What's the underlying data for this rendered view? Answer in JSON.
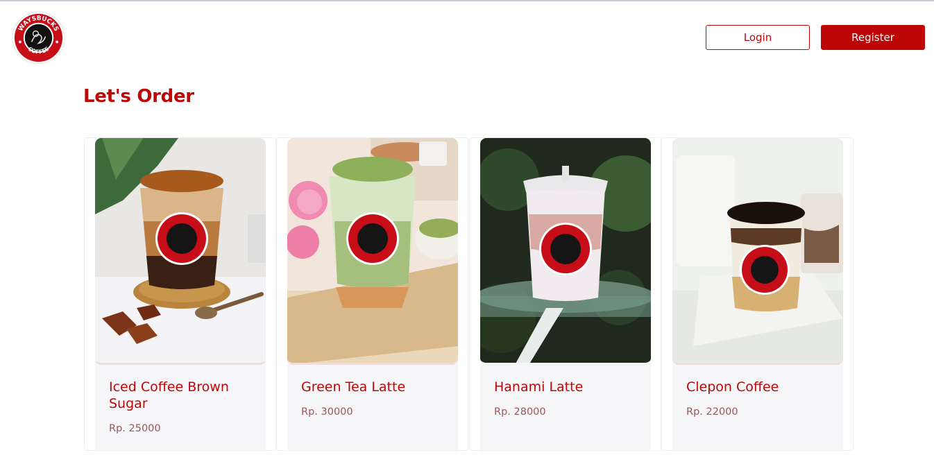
{
  "header": {
    "logo_alt": "Waysbucks Coffee logo",
    "logo_top_text": "WAYSBUCKS",
    "logo_bottom_text": "COFFEE",
    "login_label": "Login",
    "register_label": "Register"
  },
  "page": {
    "title": "Let's Order"
  },
  "colors": {
    "brand_red": "#bd0707",
    "price_text": "#975758",
    "card_bg": "#f6f6f8"
  },
  "products": [
    {
      "name": "Iced Coffee Brown Sugar",
      "price": "Rp. 25000"
    },
    {
      "name": "Green Tea Latte",
      "price": "Rp. 30000"
    },
    {
      "name": "Hanami Latte",
      "price": "Rp. 28000"
    },
    {
      "name": "Clepon Coffee",
      "price": "Rp. 22000"
    }
  ]
}
